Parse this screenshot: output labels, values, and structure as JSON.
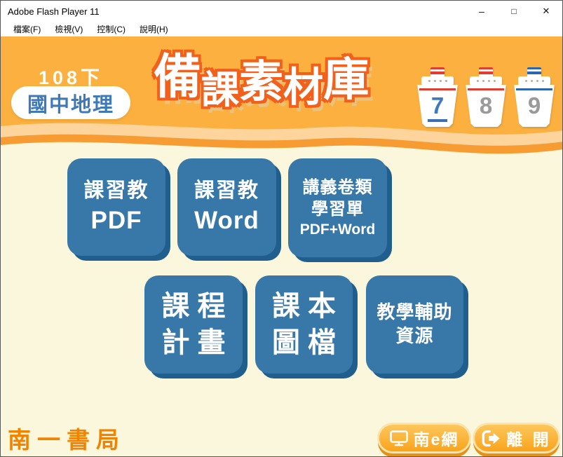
{
  "window": {
    "title": "Adobe Flash Player 11",
    "controls": {
      "minimize": "–",
      "maximize": "□",
      "close": "✕"
    }
  },
  "menu": {
    "items": [
      {
        "label": "檔案(F)"
      },
      {
        "label": "檢視(V)"
      },
      {
        "label": "控制(C)"
      },
      {
        "label": "說明(H)"
      }
    ]
  },
  "header": {
    "semester": "108下",
    "subject": "國中地理",
    "title": "備課素材庫",
    "grades": [
      {
        "number": "7",
        "active": true,
        "stripe": "red"
      },
      {
        "number": "8",
        "active": false,
        "stripe": "red"
      },
      {
        "number": "9",
        "active": false,
        "stripe": "blue"
      }
    ]
  },
  "main": {
    "buttons_row1": [
      {
        "lines": [
          "課習教",
          "PDF"
        ]
      },
      {
        "lines": [
          "課習教",
          "Word"
        ]
      },
      {
        "lines": [
          "講義卷類",
          "學習單",
          "PDF+Word"
        ]
      }
    ],
    "buttons_row2": [
      {
        "lines": [
          "課程",
          "計畫"
        ]
      },
      {
        "lines": [
          "課本",
          "圖檔"
        ]
      },
      {
        "lines": [
          "教學輔助",
          "資源"
        ]
      }
    ]
  },
  "footer": {
    "publisher": "南一書局",
    "website_button": "南e網",
    "exit_button": "離 開",
    "icons": {
      "website": "monitor-icon",
      "exit": "exit-arrow-icon"
    }
  },
  "colors": {
    "header_orange": "#fbb040",
    "wave_band": "#fcd49c",
    "wave_lip": "#f79c33",
    "body_cream": "#fbf7dc",
    "title_outline": "#f2611c",
    "subject_blue": "#3e79b8",
    "button_blue": "#3778a9",
    "button_blue_shadow": "#1f5e8d",
    "grade_active_blue": "#4179be",
    "grade_inactive_gray": "#9a9a9a",
    "stripe_red": "#e23b30",
    "stripe_blue": "#2c66b0",
    "footer_orange": "#f9a41c",
    "publisher_orange": "#f08300"
  }
}
